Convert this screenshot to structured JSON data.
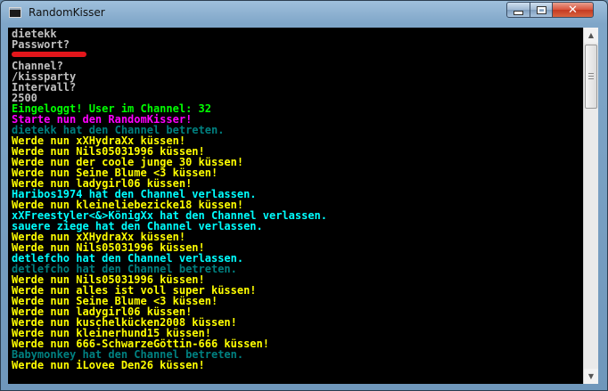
{
  "window": {
    "title": "RandomKisser",
    "icon": "console-app-icon",
    "controls": {
      "minimize": "minimize-icon",
      "maximize": "maximize-icon",
      "close": "close-icon",
      "close_glyph": "✕"
    }
  },
  "console": {
    "background": "#000000",
    "lines": [
      {
        "text": "dietekk",
        "color": "#c0c0c0"
      },
      {
        "text": "Passwort?",
        "color": "#c0c0c0"
      },
      {
        "text": "",
        "color": "#c0c0c0",
        "redacted": true
      },
      {
        "text": "Channel?",
        "color": "#c0c0c0"
      },
      {
        "text": "/kissparty",
        "color": "#c0c0c0"
      },
      {
        "text": "Intervall?",
        "color": "#c0c0c0"
      },
      {
        "text": "2500",
        "color": "#c0c0c0"
      },
      {
        "text": "Eingeloggt! User im Channel: 32",
        "color": "#00ff00"
      },
      {
        "text": "Starte nun den RandomKisser!",
        "color": "#ff00ff"
      },
      {
        "text": "dietekk hat den Channel betreten.",
        "color": "#008080"
      },
      {
        "text": "Werde nun xXHydraXx küssen!",
        "color": "#ffff00"
      },
      {
        "text": "Werde nun Nils05031996 küssen!",
        "color": "#ffff00"
      },
      {
        "text": "Werde nun der coole junge 30 küssen!",
        "color": "#ffff00"
      },
      {
        "text": "Werde nun Seine Blume <3 küssen!",
        "color": "#ffff00"
      },
      {
        "text": "Werde nun ladygirl06 küssen!",
        "color": "#ffff00"
      },
      {
        "text": "Haribos1974 hat den Channel verlassen.",
        "color": "#00ffff"
      },
      {
        "text": "Werde nun kleineliebezicke18 küssen!",
        "color": "#ffff00"
      },
      {
        "text": "xXFreestyler<&>KönigXx hat den Channel verlassen.",
        "color": "#00ffff"
      },
      {
        "text": "sauere ziege hat den Channel verlassen.",
        "color": "#00ffff"
      },
      {
        "text": "Werde nun xXHydraXx küssen!",
        "color": "#ffff00"
      },
      {
        "text": "Werde nun Nils05031996 küssen!",
        "color": "#ffff00"
      },
      {
        "text": "detlefcho hat den Channel verlassen.",
        "color": "#00ffff"
      },
      {
        "text": "detlefcho hat den Channel betreten.",
        "color": "#008080"
      },
      {
        "text": "Werde nun Nils05031996 küssen!",
        "color": "#ffff00"
      },
      {
        "text": "Werde nun alles ist voll super küssen!",
        "color": "#ffff00"
      },
      {
        "text": "Werde nun Seine Blume <3 küssen!",
        "color": "#ffff00"
      },
      {
        "text": "Werde nun ladygirl06 küssen!",
        "color": "#ffff00"
      },
      {
        "text": "Werde nun kuschelkücken2008 küssen!",
        "color": "#ffff00"
      },
      {
        "text": "Werde nun kleinerhund15 küssen!",
        "color": "#ffff00"
      },
      {
        "text": "Werde nun 666-SchwarzeGöttin-666 küssen!",
        "color": "#ffff00"
      },
      {
        "text": "Babymonkey hat den Channel betreten.",
        "color": "#008080"
      },
      {
        "text": "Werde nun iLovee Den26 küssen!",
        "color": "#ffff00"
      }
    ]
  },
  "scrollbar": {
    "up_icon": "scroll-up-arrow-icon",
    "down_icon": "scroll-down-arrow-icon",
    "up_glyph": "▲",
    "down_glyph": "▼"
  }
}
